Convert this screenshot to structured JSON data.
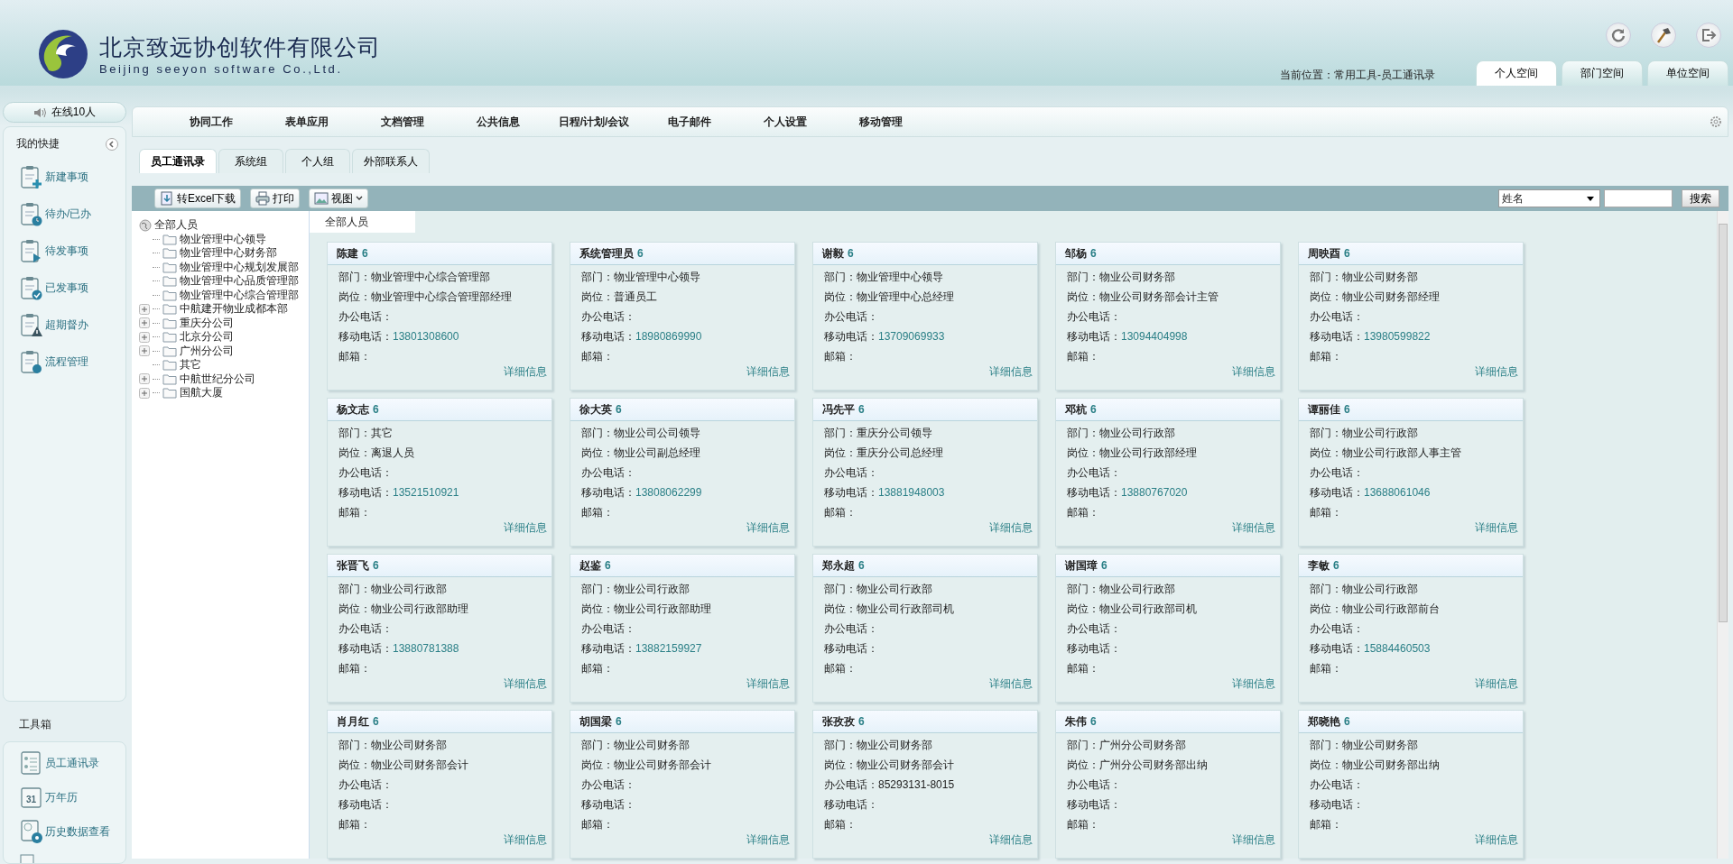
{
  "header": {
    "company_cn": "北京致远协创软件有限公司",
    "company_en": "Beijing seeyon software Co.,Ltd.",
    "breadcrumb": "当前位置：常用工具-员工通讯录"
  },
  "space_tabs": [
    {
      "label": "个人空间",
      "selected": true
    },
    {
      "label": "部门空间",
      "selected": false
    },
    {
      "label": "单位空间",
      "selected": false
    }
  ],
  "sidebar": {
    "online": "在线10人",
    "shortcuts_title": "我的快捷",
    "shortcuts": [
      {
        "label": "新建事项",
        "kind": "new"
      },
      {
        "label": "待办/已办",
        "kind": "clock"
      },
      {
        "label": "待发事项",
        "kind": "send"
      },
      {
        "label": "已发事项",
        "kind": "done"
      },
      {
        "label": "超期督办",
        "kind": "warn"
      },
      {
        "label": "流程管理",
        "kind": "flow"
      }
    ],
    "toolbox_title": "工具箱",
    "tools": [
      {
        "label": "员工通讯录",
        "kind": "list"
      },
      {
        "label": "万年历",
        "kind": "calendar",
        "icon_label": "31"
      },
      {
        "label": "历史数据查看",
        "kind": "history"
      }
    ]
  },
  "nav": [
    "协同工作",
    "表单应用",
    "文档管理",
    "公共信息",
    "日程/计划/会议",
    "电子邮件",
    "个人设置",
    "移动管理"
  ],
  "sub_tabs": [
    {
      "label": "员工通讯录",
      "selected": true
    },
    {
      "label": "系统组",
      "selected": false
    },
    {
      "label": "个人组",
      "selected": false
    },
    {
      "label": "外部联系人",
      "selected": false
    }
  ],
  "toolbar": {
    "buttons": [
      {
        "label": "转Excel下载",
        "kind": "excel"
      },
      {
        "label": "打印",
        "kind": "print"
      },
      {
        "label": "视图",
        "kind": "view"
      }
    ],
    "search_field": "姓名",
    "search_button": "搜索"
  },
  "tree": {
    "label": "全部人员",
    "children": [
      {
        "label": "物业管理中心领导",
        "expandable": false
      },
      {
        "label": "物业管理中心财务部",
        "expandable": false
      },
      {
        "label": "物业管理中心规划发展部",
        "expandable": false
      },
      {
        "label": "物业管理中心品质管理部",
        "expandable": false
      },
      {
        "label": "物业管理中心综合管理部",
        "expandable": false
      },
      {
        "label": "中航建开物业成都本部",
        "expandable": true
      },
      {
        "label": "重庆分公司",
        "expandable": true
      },
      {
        "label": "北京分公司",
        "expandable": true
      },
      {
        "label": "广州分公司",
        "expandable": true
      },
      {
        "label": "其它",
        "expandable": false
      },
      {
        "label": "中航世纪分公司",
        "expandable": true
      },
      {
        "label": "国航大厦",
        "expandable": true
      }
    ]
  },
  "cards_title": "全部人员",
  "cards": [
    {
      "name": "陈建",
      "count": "6",
      "fields": [
        {
          "label": "部门：",
          "value": "物业管理中心综合管理部",
          "kind": "text"
        },
        {
          "label": "岗位：",
          "value": "物业管理中心综合管理部经理",
          "kind": "text"
        },
        {
          "label": "办公电话："
        },
        {
          "label": "移动电话：",
          "value": "13801308600",
          "kind": "phone"
        },
        {
          "label": "邮箱："
        }
      ],
      "link": "详细信息"
    },
    {
      "name": "系统管理员",
      "count": "6",
      "fields": [
        {
          "label": "部门：",
          "value": "物业管理中心领导",
          "kind": "text"
        },
        {
          "label": "岗位：",
          "value": "普通员工",
          "kind": "text"
        },
        {
          "label": "办公电话："
        },
        {
          "label": "移动电话：",
          "value": "18980869990",
          "kind": "phone"
        },
        {
          "label": "邮箱："
        }
      ],
      "link": "详细信息"
    },
    {
      "name": "谢毅",
      "count": "6",
      "fields": [
        {
          "label": "部门：",
          "value": "物业管理中心领导",
          "kind": "text"
        },
        {
          "label": "岗位：",
          "value": "物业管理中心总经理",
          "kind": "text"
        },
        {
          "label": "办公电话："
        },
        {
          "label": "移动电话：",
          "value": "13709069933",
          "kind": "phone"
        },
        {
          "label": "邮箱："
        }
      ],
      "link": "详细信息"
    },
    {
      "name": "邹杨",
      "count": "6",
      "fields": [
        {
          "label": "部门：",
          "value": "物业公司财务部",
          "kind": "text"
        },
        {
          "label": "岗位：",
          "value": "物业公司财务部会计主管",
          "kind": "text"
        },
        {
          "label": "办公电话："
        },
        {
          "label": "移动电话：",
          "value": "13094404998",
          "kind": "phone"
        },
        {
          "label": "邮箱："
        }
      ],
      "link": "详细信息"
    },
    {
      "name": "周映酉",
      "count": "6",
      "fields": [
        {
          "label": "部门：",
          "value": "物业公司财务部",
          "kind": "text"
        },
        {
          "label": "岗位：",
          "value": "物业公司财务部经理",
          "kind": "text"
        },
        {
          "label": "办公电话："
        },
        {
          "label": "移动电话：",
          "value": "13980599822",
          "kind": "phone"
        },
        {
          "label": "邮箱："
        }
      ],
      "link": "详细信息"
    },
    {
      "name": "杨文志",
      "count": "6",
      "fields": [
        {
          "label": "部门：",
          "value": "其它",
          "kind": "text"
        },
        {
          "label": "岗位：",
          "value": "离退人员",
          "kind": "text"
        },
        {
          "label": "办公电话："
        },
        {
          "label": "移动电话：",
          "value": "13521510921",
          "kind": "phone"
        },
        {
          "label": "邮箱："
        }
      ],
      "link": "详细信息"
    },
    {
      "name": "徐大英",
      "count": "6",
      "fields": [
        {
          "label": "部门：",
          "value": "物业公司公司领导",
          "kind": "text"
        },
        {
          "label": "岗位：",
          "value": "物业公司副总经理",
          "kind": "text"
        },
        {
          "label": "办公电话："
        },
        {
          "label": "移动电话：",
          "value": "13808062299",
          "kind": "phone"
        },
        {
          "label": "邮箱："
        }
      ],
      "link": "详细信息"
    },
    {
      "name": "冯先平",
      "count": "6",
      "fields": [
        {
          "label": "部门：",
          "value": "重庆分公司领导",
          "kind": "text"
        },
        {
          "label": "岗位：",
          "value": "重庆分公司总经理",
          "kind": "text"
        },
        {
          "label": "办公电话："
        },
        {
          "label": "移动电话：",
          "value": "13881948003",
          "kind": "phone"
        },
        {
          "label": "邮箱："
        }
      ],
      "link": "详细信息"
    },
    {
      "name": "邓杭",
      "count": "6",
      "fields": [
        {
          "label": "部门：",
          "value": "物业公司行政部",
          "kind": "text"
        },
        {
          "label": "岗位：",
          "value": "物业公司行政部经理",
          "kind": "text"
        },
        {
          "label": "办公电话："
        },
        {
          "label": "移动电话：",
          "value": "13880767020",
          "kind": "phone"
        },
        {
          "label": "邮箱："
        }
      ],
      "link": "详细信息"
    },
    {
      "name": "谭丽佳",
      "count": "6",
      "fields": [
        {
          "label": "部门：",
          "value": "物业公司行政部",
          "kind": "text"
        },
        {
          "label": "岗位：",
          "value": "物业公司行政部人事主管",
          "kind": "text"
        },
        {
          "label": "办公电话："
        },
        {
          "label": "移动电话：",
          "value": "13688061046",
          "kind": "phone"
        },
        {
          "label": "邮箱："
        }
      ],
      "link": "详细信息"
    },
    {
      "name": "张晋飞",
      "count": "6",
      "fields": [
        {
          "label": "部门：",
          "value": "物业公司行政部",
          "kind": "text"
        },
        {
          "label": "岗位：",
          "value": "物业公司行政部助理",
          "kind": "text"
        },
        {
          "label": "办公电话："
        },
        {
          "label": "移动电话：",
          "value": "13880781388",
          "kind": "phone"
        },
        {
          "label": "邮箱："
        }
      ],
      "link": "详细信息"
    },
    {
      "name": "赵鉴",
      "count": "6",
      "fields": [
        {
          "label": "部门：",
          "value": "物业公司行政部",
          "kind": "text"
        },
        {
          "label": "岗位：",
          "value": "物业公司行政部助理",
          "kind": "text"
        },
        {
          "label": "办公电话："
        },
        {
          "label": "移动电话：",
          "value": "13882159927",
          "kind": "phone"
        },
        {
          "label": "邮箱："
        }
      ],
      "link": "详细信息"
    },
    {
      "name": "郑永超",
      "count": "6",
      "fields": [
        {
          "label": "部门：",
          "value": "物业公司行政部",
          "kind": "text"
        },
        {
          "label": "岗位：",
          "value": "物业公司行政部司机",
          "kind": "text"
        },
        {
          "label": "办公电话："
        },
        {
          "label": "移动电话："
        },
        {
          "label": "邮箱："
        }
      ],
      "link": "详细信息"
    },
    {
      "name": "谢国璋",
      "count": "6",
      "fields": [
        {
          "label": "部门：",
          "value": "物业公司行政部",
          "kind": "text"
        },
        {
          "label": "岗位：",
          "value": "物业公司行政部司机",
          "kind": "text"
        },
        {
          "label": "办公电话："
        },
        {
          "label": "移动电话："
        },
        {
          "label": "邮箱："
        }
      ],
      "link": "详细信息"
    },
    {
      "name": "李敏",
      "count": "6",
      "fields": [
        {
          "label": "部门：",
          "value": "物业公司行政部",
          "kind": "text"
        },
        {
          "label": "岗位：",
          "value": "物业公司行政部前台",
          "kind": "text"
        },
        {
          "label": "办公电话："
        },
        {
          "label": "移动电话：",
          "value": "15884460503",
          "kind": "phone"
        },
        {
          "label": "邮箱："
        }
      ],
      "link": "详细信息"
    },
    {
      "name": "肖月红",
      "count": "6",
      "fields": [
        {
          "label": "部门：",
          "value": "物业公司财务部",
          "kind": "text"
        },
        {
          "label": "岗位：",
          "value": "物业公司财务部会计",
          "kind": "text"
        },
        {
          "label": "办公电话："
        },
        {
          "label": "移动电话："
        },
        {
          "label": "邮箱："
        }
      ],
      "link": "详细信息"
    },
    {
      "name": "胡国梁",
      "count": "6",
      "fields": [
        {
          "label": "部门：",
          "value": "物业公司财务部",
          "kind": "text"
        },
        {
          "label": "岗位：",
          "value": "物业公司财务部会计",
          "kind": "text"
        },
        {
          "label": "办公电话："
        },
        {
          "label": "移动电话："
        },
        {
          "label": "邮箱："
        }
      ],
      "link": "详细信息"
    },
    {
      "name": "张孜孜",
      "count": "6",
      "fields": [
        {
          "label": "部门：",
          "value": "物业公司财务部",
          "kind": "text"
        },
        {
          "label": "岗位：",
          "value": "物业公司财务部会计",
          "kind": "text"
        },
        {
          "label": "办公电话：",
          "value": "85293131-8015",
          "kind": "text"
        },
        {
          "label": "移动电话："
        },
        {
          "label": "邮箱："
        }
      ],
      "link": "详细信息"
    },
    {
      "name": "朱伟",
      "count": "6",
      "fields": [
        {
          "label": "部门：",
          "value": "广州分公司财务部",
          "kind": "text"
        },
        {
          "label": "岗位：",
          "value": "广州分公司财务部出纳",
          "kind": "text"
        },
        {
          "label": "办公电话："
        },
        {
          "label": "移动电话："
        },
        {
          "label": "邮箱："
        }
      ],
      "link": "详细信息"
    },
    {
      "name": "郑晓艳",
      "count": "6",
      "fields": [
        {
          "label": "部门：",
          "value": "物业公司财务部",
          "kind": "text"
        },
        {
          "label": "岗位：",
          "value": "物业公司财务部出纳",
          "kind": "text"
        },
        {
          "label": "办公电话："
        },
        {
          "label": "移动电话："
        },
        {
          "label": "邮箱："
        }
      ],
      "link": "详细信息"
    }
  ]
}
